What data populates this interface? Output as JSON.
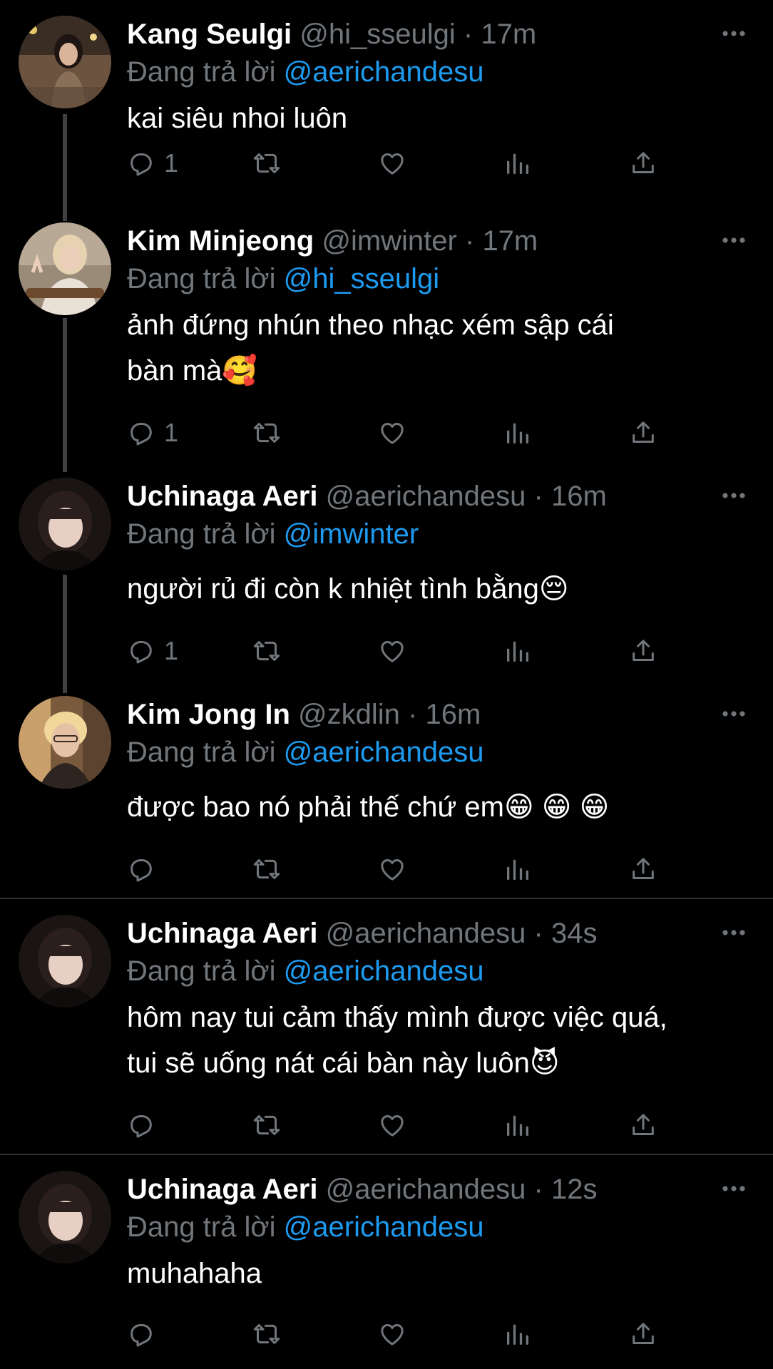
{
  "colors": {
    "background": "#000000",
    "name": "#ffffff",
    "secondary": "#71767b",
    "mention": "#1d9bf0",
    "thread_line": "#3e4144",
    "divider": "#2f3336"
  },
  "replying_prefix": "Đang trả lời",
  "icons": [
    "more-icon",
    "reply-icon",
    "retweet-icon",
    "like-icon",
    "analytics-icon",
    "share-icon"
  ],
  "tweets": [
    {
      "name": "Kang Seulgi",
      "handle": "@hi_sseulgi",
      "dot": "·",
      "time": "17m",
      "replying_to": "@aerichandesu",
      "lines": [
        "kai siêu nhoi luôn"
      ],
      "reply_count": "1"
    },
    {
      "name": "Kim Minjeong",
      "handle": "@imwinter",
      "dot": "·",
      "time": "17m",
      "replying_to": "@hi_sseulgi",
      "lines": [
        "ảnh đứng nhún theo nhạc xém sập cái",
        "bàn mà🥰"
      ],
      "reply_count": "1"
    },
    {
      "name": "Uchinaga Aeri",
      "handle": "@aerichandesu",
      "dot": "·",
      "time": "16m",
      "replying_to": "@imwinter",
      "lines": [
        "người rủ đi còn k nhiệt tình bằng😔"
      ],
      "reply_count": "1"
    },
    {
      "name": "Kim Jong In",
      "handle": "@zkdlin",
      "dot": "·",
      "time": "16m",
      "replying_to": "@aerichandesu",
      "lines": [
        "được bao nó phải thế chứ em😁 😁 😁"
      ],
      "reply_count": ""
    },
    {
      "name": "Uchinaga Aeri",
      "handle": "@aerichandesu",
      "dot": "·",
      "time": "34s",
      "replying_to": "@aerichandesu",
      "lines": [
        "hôm nay tui cảm thấy mình được việc quá,",
        "tui sẽ uống nát cái bàn này luôn😈"
      ],
      "reply_count": ""
    },
    {
      "name": "Uchinaga Aeri",
      "handle": "@aerichandesu",
      "dot": "·",
      "time": "12s",
      "replying_to": "@aerichandesu",
      "lines": [
        "muhahaha"
      ],
      "reply_count": ""
    }
  ]
}
